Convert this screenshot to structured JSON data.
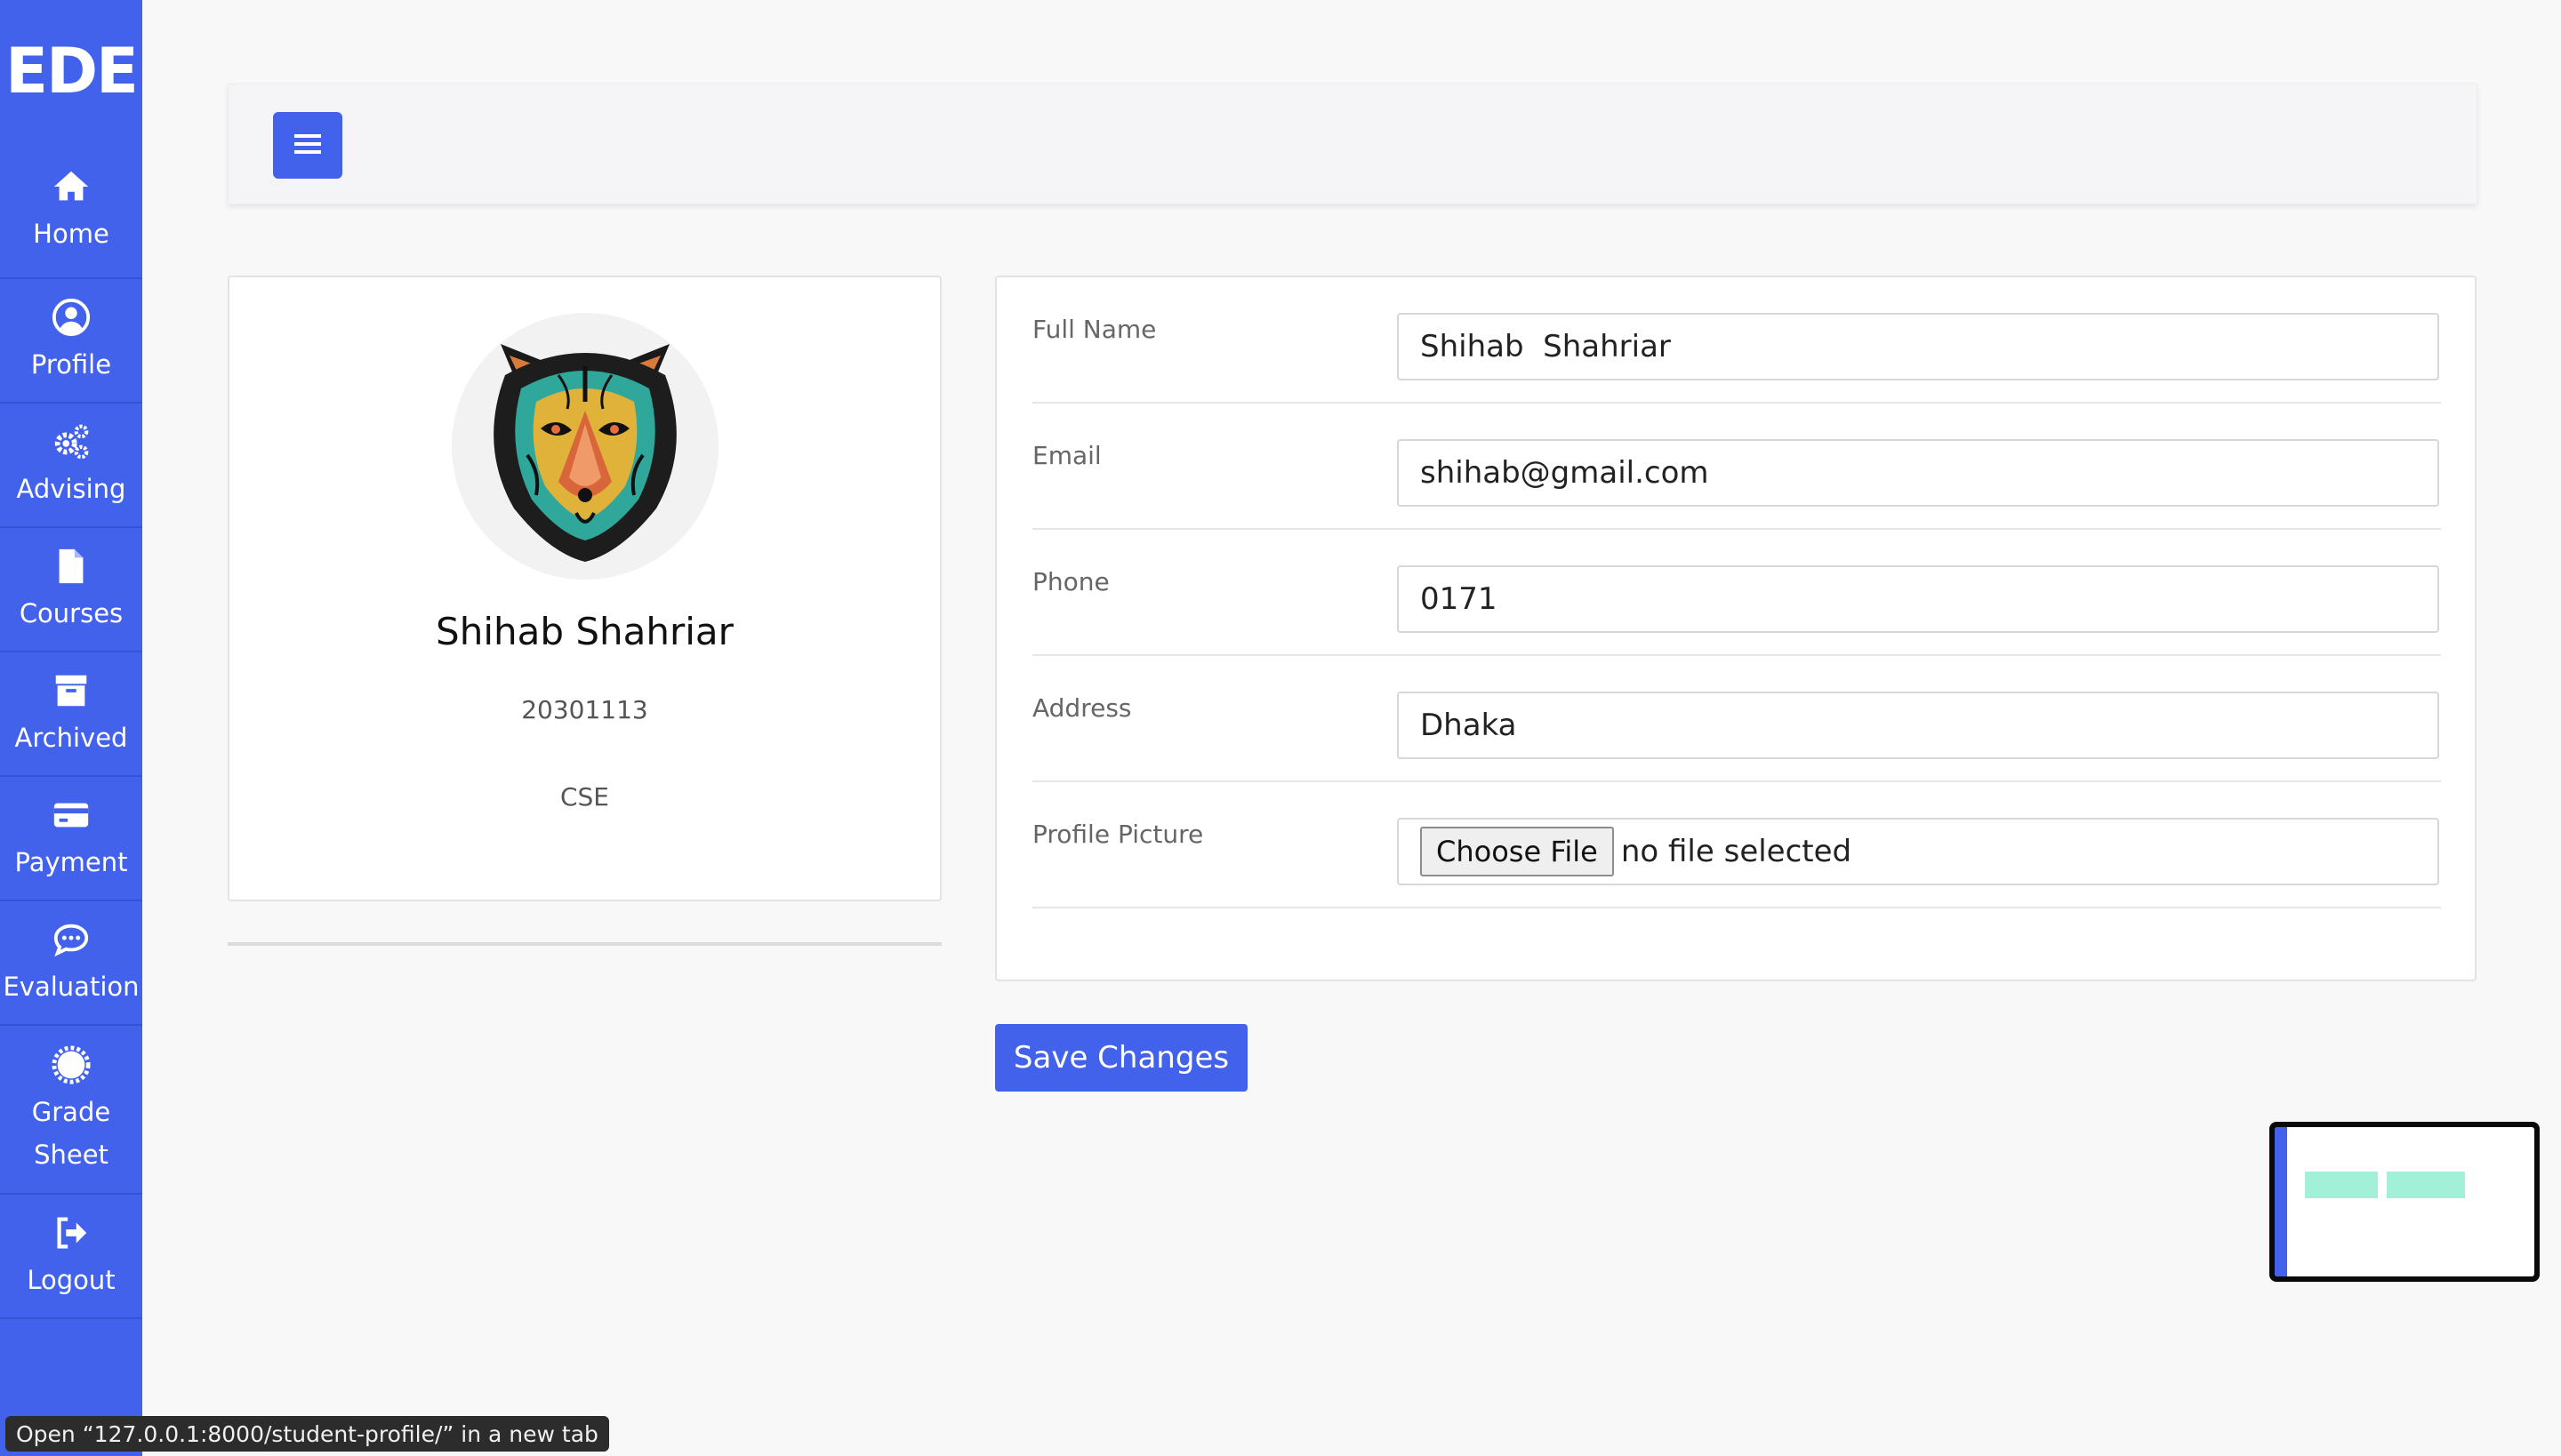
{
  "app": {
    "logo": "EDE",
    "accent_color": "#4262ec"
  },
  "sidebar": {
    "items": [
      {
        "label": "Home",
        "icon": "home-icon"
      },
      {
        "label": "Profile",
        "icon": "user-circle-icon"
      },
      {
        "label": "Advising",
        "icon": "gears-icon"
      },
      {
        "label": "Courses",
        "icon": "file-icon"
      },
      {
        "label": "Archived",
        "icon": "archive-icon"
      },
      {
        "label": "Payment",
        "icon": "credit-card-icon"
      },
      {
        "label": "Evaluation",
        "icon": "comment-dots-icon"
      },
      {
        "label": "Grade Sheet",
        "icon": "certificate-icon"
      },
      {
        "label": "Logout",
        "icon": "sign-out-icon"
      }
    ]
  },
  "topbar": {
    "menu_icon": "hamburger-icon"
  },
  "profile": {
    "name": "Shihab Shahriar",
    "id": "20301113",
    "department": "CSE"
  },
  "form": {
    "full_name_label": "Full Name",
    "full_name_value": "Shihab  Shahriar",
    "email_label": "Email",
    "email_value": "shihab@gmail.com",
    "phone_label": "Phone",
    "phone_value": "0171",
    "address_label": "Address",
    "address_value": "Dhaka",
    "picture_label": "Profile Picture",
    "file_button": "Choose File",
    "file_status": "no file selected",
    "save_label": "Save Changes"
  },
  "status_bar": {
    "text": "Open “127.0.0.1:8000/student-profile/” in a new tab"
  }
}
